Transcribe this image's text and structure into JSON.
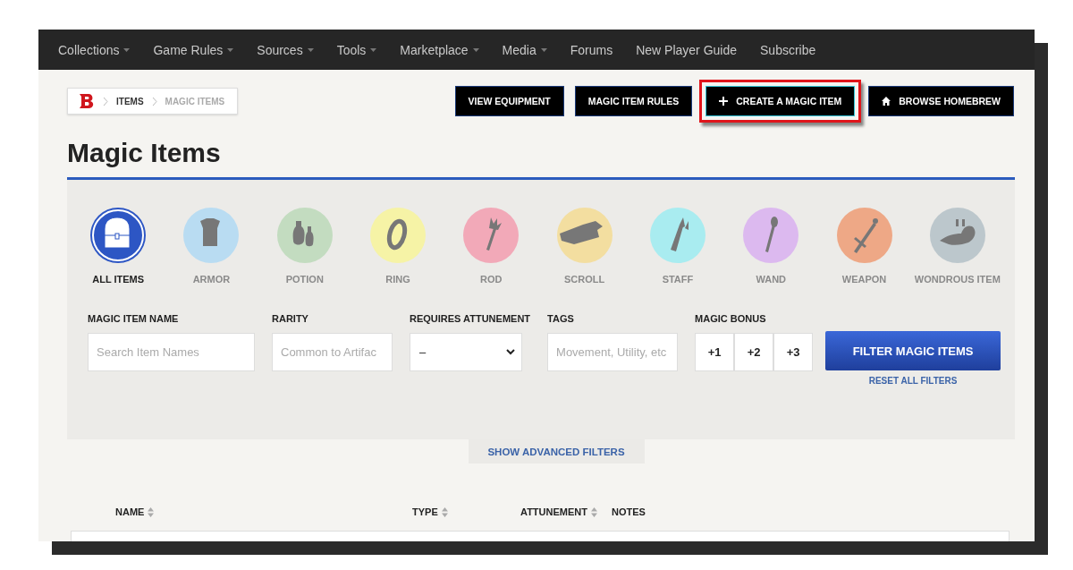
{
  "nav": {
    "items": [
      {
        "label": "Collections",
        "dropdown": true
      },
      {
        "label": "Game Rules",
        "dropdown": true
      },
      {
        "label": "Sources",
        "dropdown": true
      },
      {
        "label": "Tools",
        "dropdown": true
      },
      {
        "label": "Marketplace",
        "dropdown": true
      },
      {
        "label": "Media",
        "dropdown": true
      },
      {
        "label": "Forums",
        "dropdown": false
      },
      {
        "label": "New Player Guide",
        "dropdown": false
      },
      {
        "label": "Subscribe",
        "dropdown": false
      }
    ]
  },
  "breadcrumb": {
    "items": [
      {
        "label": "ITEMS",
        "current": false
      },
      {
        "label": "MAGIC ITEMS",
        "current": true
      }
    ]
  },
  "actions": [
    {
      "label": "VIEW EQUIPMENT",
      "kind": "plain",
      "highlighted": false
    },
    {
      "label": "MAGIC ITEM RULES",
      "kind": "plain",
      "highlighted": false
    },
    {
      "label": "CREATE A MAGIC ITEM",
      "kind": "plus",
      "highlighted": true
    },
    {
      "label": "BROWSE HOMEBREW",
      "kind": "home",
      "highlighted": false
    }
  ],
  "title": "Magic Items",
  "categories": [
    {
      "label": "ALL ITEMS",
      "kind": "chest",
      "selected": true,
      "color": "#2d56c4"
    },
    {
      "label": "ARMOR",
      "kind": "shirt",
      "selected": false,
      "color": "#b9dcf2"
    },
    {
      "label": "POTION",
      "kind": "bottles",
      "selected": false,
      "color": "#c3dcc0"
    },
    {
      "label": "RING",
      "kind": "ring",
      "selected": false,
      "color": "#f6f3a6"
    },
    {
      "label": "ROD",
      "kind": "rod",
      "selected": false,
      "color": "#f2a9b8"
    },
    {
      "label": "SCROLL",
      "kind": "scroll",
      "selected": false,
      "color": "#f3dea0"
    },
    {
      "label": "STAFF",
      "kind": "staff",
      "selected": false,
      "color": "#a9ecf0"
    },
    {
      "label": "WAND",
      "kind": "wand",
      "selected": false,
      "color": "#dcb9ef"
    },
    {
      "label": "WEAPON",
      "kind": "sword",
      "selected": false,
      "color": "#eea886"
    },
    {
      "label": "WONDROUS ITEM",
      "kind": "creature",
      "selected": false,
      "color": "#bcc7cc"
    }
  ],
  "filters": {
    "name": {
      "label": "MAGIC ITEM NAME",
      "placeholder": "Search Item Names"
    },
    "rarity": {
      "label": "RARITY",
      "placeholder": "Common to Artifac"
    },
    "attunement": {
      "label": "REQUIRES ATTUNEMENT",
      "value": "–"
    },
    "tags": {
      "label": "TAGS",
      "placeholder": "Movement, Utility, etc"
    },
    "bonus": {
      "label": "MAGIC BONUS",
      "options": [
        "+1",
        "+2",
        "+3"
      ]
    },
    "submit": "FILTER MAGIC ITEMS",
    "reset": "RESET ALL FILTERS"
  },
  "advanced": "SHOW ADVANCED FILTERS",
  "table": {
    "columns": [
      {
        "label": "NAME",
        "sortable": true
      },
      {
        "label": "TYPE",
        "sortable": true
      },
      {
        "label": "ATTUNEMENT",
        "sortable": true
      },
      {
        "label": "NOTES",
        "sortable": false
      }
    ]
  }
}
